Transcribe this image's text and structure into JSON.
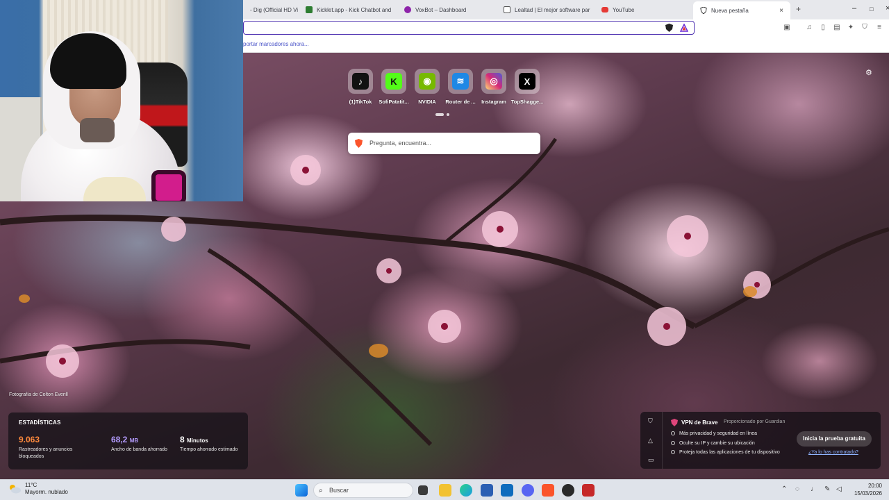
{
  "browser": {
    "tabs": [
      {
        "title": "- Dig (Official HD Vi",
        "icon": "music-video-icon",
        "color": "#6b6b6b"
      },
      {
        "title": "Kicklet.app - Kick Chatbot and",
        "icon": "kicklet-icon",
        "color": "#2e7d32"
      },
      {
        "title": "VoxBot – Dashboard",
        "icon": "voxbot-icon",
        "color": "#8e24aa"
      },
      {
        "title": "Lealtad | El mejor software par",
        "icon": "lealtad-icon",
        "color": "#1565c0"
      },
      {
        "title": "YouTube",
        "icon": "youtube-icon",
        "color": "#e53935"
      },
      {
        "title": "Nueva pestaña",
        "icon": "brave-shield-icon",
        "color": "#555555",
        "active": true
      }
    ],
    "new_tab_symbol": "+",
    "close_symbol": "×",
    "window_controls": {
      "minimize": "–",
      "maximize": "□",
      "close": "×"
    },
    "bookmarks_prompt": "portar marcadores ahora...",
    "toolbar_icons": [
      "tab-search-icon",
      "media-icon",
      "sidebar-icon",
      "wallet-icon",
      "leo-ai-icon",
      "vpn-icon",
      "menu-icon"
    ]
  },
  "new_tab": {
    "top_sites": [
      {
        "label": "(1)TikTok",
        "icon": "tiktok-icon",
        "glyph": "♪",
        "bg": "#111111"
      },
      {
        "label": "SofiPatatit...",
        "icon": "kick-icon",
        "glyph": "K",
        "bg": "#53fc18"
      },
      {
        "label": "NVIDIA",
        "icon": "nvidia-icon",
        "glyph": "◉",
        "bg": "#76b900"
      },
      {
        "label": "Router de ...",
        "icon": "wifi-icon",
        "glyph": "≋",
        "bg": "#1e88e5"
      },
      {
        "label": "Instagram",
        "icon": "instagram-icon",
        "glyph": "◎",
        "bg": "#d62976"
      },
      {
        "label": "TopShagge...",
        "icon": "x-icon",
        "glyph": "X",
        "bg": "#000000"
      }
    ],
    "search_placeholder": "Pregunta, encuentra...",
    "photo_credit": "Fotografía de Colton Everill",
    "stats": {
      "title": "ESTADÍSTICAS",
      "blocked": {
        "value": "9.063",
        "desc": "Rastreadores y anuncios bloqueados",
        "color": "#ff8a3d"
      },
      "bandwidth": {
        "value": "68,2",
        "unit": "MB",
        "desc": "Ancho de banda ahorrado",
        "color": "#b49cff"
      },
      "time": {
        "value": "8",
        "unit": "Minutos",
        "desc": "Tiempo ahorrado estimado",
        "color": "#ffffff"
      }
    },
    "vpn": {
      "title": "VPN de Brave",
      "provider": "Proporcionado por Guardian",
      "features": [
        "Más privacidad y seguridad en línea",
        "Oculte su IP y cambie su ubicación",
        "Proteja todas las aplicaciones de tu dispositivo"
      ],
      "cta": "Inicia la prueba gratuita",
      "link": "¿Ya lo has contratado?"
    }
  },
  "taskbar": {
    "weather": {
      "temp": "11°C",
      "desc": "Mayorm. nublado"
    },
    "search_label": "Buscar",
    "clock": {
      "time": "20:00",
      "date": "15/03/2026"
    },
    "apps": [
      {
        "name": "windows-start-icon",
        "color": "#0a64d8"
      },
      {
        "name": "task-view-icon",
        "color": "#444444"
      },
      {
        "name": "file-explorer-icon",
        "color": "#f2c232"
      },
      {
        "name": "edge-icon",
        "color": "#1b9de2"
      },
      {
        "name": "store-icon",
        "color": "#2b5fb3"
      },
      {
        "name": "outlook-icon",
        "color": "#0f6cbd"
      },
      {
        "name": "discord-icon",
        "color": "#5865f2"
      },
      {
        "name": "brave-icon",
        "color": "#fb542b"
      },
      {
        "name": "obs-icon",
        "color": "#2a2a2a"
      },
      {
        "name": "app-icon",
        "color": "#c62828"
      }
    ],
    "tray_icons": [
      "chevron-up-icon",
      "network-icon",
      "microphone-icon",
      "pen-icon",
      "volume-icon"
    ]
  }
}
